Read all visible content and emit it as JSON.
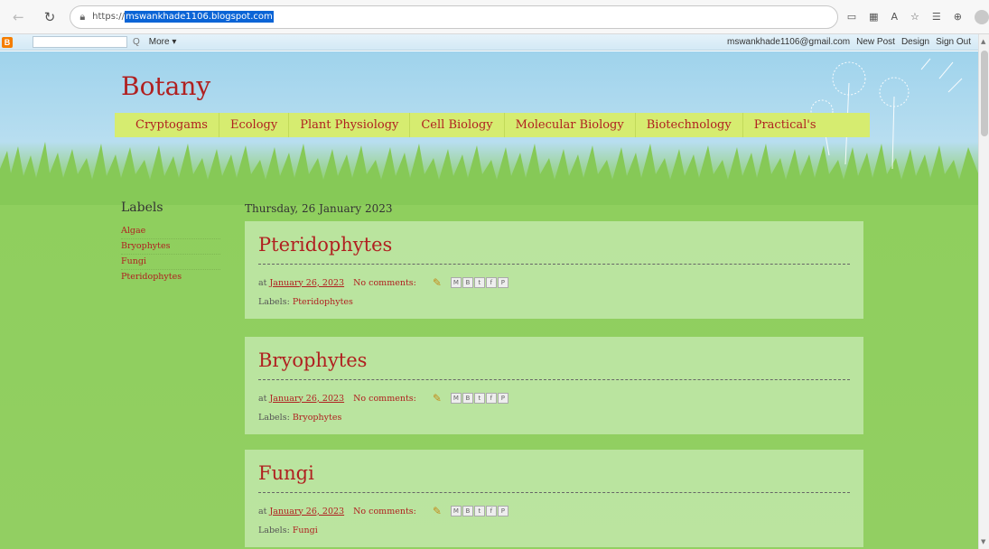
{
  "browser": {
    "url_prefix": "https://",
    "url_selected": "mswankhade1106.blogspot.com",
    "icons": [
      "back-arrow-icon",
      "reload-icon",
      "lock-icon",
      "tab-icon",
      "grid-icon",
      "read-aloud-icon",
      "favorite-icon",
      "favorites-icon",
      "collections-icon",
      "profile-icon"
    ]
  },
  "navbar": {
    "search_placeholder": "",
    "search_glyph": "Q",
    "more": "More ▾",
    "email": "mswankhade1106@gmail.com",
    "new_post": "New Post",
    "design": "Design",
    "sign_out": "Sign Out"
  },
  "blog": {
    "title": "Botany",
    "tabs": [
      "Cryptogams",
      "Ecology",
      "Plant Physiology",
      "Cell Biology",
      "Molecular Biology",
      "Biotechnology",
      "Practical's"
    ]
  },
  "sidebar": {
    "title": "Labels",
    "labels": [
      "Algae",
      "Bryophytes",
      "Fungi",
      "Pteridophytes"
    ]
  },
  "main": {
    "date": "Thursday, 26 January 2023",
    "posts": [
      {
        "title": "Pteridophytes",
        "at": "at",
        "date": "January 26, 2023",
        "comments": "No comments:",
        "labels_prefix": "Labels:",
        "label": "Pteridophytes"
      },
      {
        "title": "Bryophytes",
        "at": "at",
        "date": "January 26, 2023",
        "comments": "No comments:",
        "labels_prefix": "Labels:",
        "label": "Bryophytes"
      },
      {
        "title": "Fungi",
        "at": "at",
        "date": "January 26, 2023",
        "comments": "No comments:",
        "labels_prefix": "Labels:",
        "label": "Fungi"
      }
    ],
    "share_buttons": [
      "M",
      "B",
      "t",
      "f",
      "P"
    ]
  },
  "colors": {
    "accent": "#b02020",
    "tab_bar": "#d6ec70",
    "grass": "#8fcf5e",
    "sky": "#9fd3ec"
  }
}
